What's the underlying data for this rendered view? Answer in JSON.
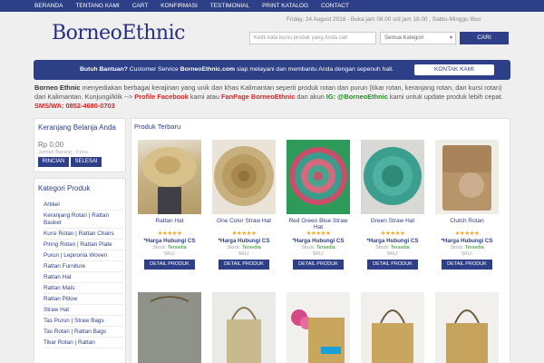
{
  "nav": [
    "BERANDA",
    "TENTANG KAMI",
    "CART",
    "KONFIRMASI",
    "TESTIMONIAL",
    "PRINT KATALOG",
    "CONTACT"
  ],
  "logo": "BorneoEthnic",
  "header": {
    "date_info": "Friday, 24 August 2018 - Buka jam 08.00 s/d jam 18.00 , Sabtu-Minggu libur",
    "search_placeholder": "Ketik kata kunci produk yang Anda cari",
    "category_select": "Semua Kategori",
    "search_button": "CARI"
  },
  "help": {
    "lead": "Butuh Bantuan?",
    "text1": " Customer Service ",
    "brand": "BorneoEthnic.com",
    "text2": " siap melayani dan membantu Anda dengan sepenuh hati.",
    "button": "KONTAK KAMI"
  },
  "intro": {
    "brand": "Borneo Ethnic",
    "p1": " menyediakan berbagai kerajinan yang unik dan khas Kalimantan seperti produk rotan dan purun (tikar rotan, keranjang rotan, dan kursi rotan) dari Kalimantan. Kunjungi/klik --> ",
    "fb": "Profile Facebook",
    "p2": " kami atau ",
    "fp": "FanPage BorneoEthnic",
    "p3": " dan akun ",
    "ig": "IG: @BorneoEthnic",
    "p4": " kami untuk update produk lebih cepat. ",
    "sms": "SMS/WA: 0852-4680-0703"
  },
  "cart": {
    "title": "Keranjang Belanja Anda",
    "total": "Rp 0,00",
    "count": "Jumlah Barang : 0 pcs",
    "btn_details": "RINCIAN",
    "btn_done": "SELESAI"
  },
  "categories": {
    "title": "Kategori Produk",
    "items": [
      "Artikel",
      "Keranjang Rotan | Rattan Basket",
      "Kursi Rotan | Rattan Chairs",
      "Piring Rotan | Rattan Plate",
      "Purun | Lepironia Woven",
      "Rattan Furniture",
      "Rattan Hat",
      "Rattan Mats",
      "Rattan Pillow",
      "Straw Hat",
      "Tas Purun | Straw Bags",
      "Tas Rotan | Rattan Bags",
      "Tikar Rotan | Rattan"
    ]
  },
  "products": {
    "title": "Produk Terbaru",
    "items": [
      {
        "name": "Rattan Hat",
        "stars": "★★★★★",
        "price": "*Harga Hubungi CS",
        "stock_label": "Stock: ",
        "stock": "Tersedia",
        "sku": "SKU:",
        "btn": "DETAIL PRODUK"
      },
      {
        "name": "One Color Straw Hat",
        "stars": "★★★★★",
        "price": "*Harga Hubungi CS",
        "stock_label": "Stock: ",
        "stock": "Tersedia",
        "sku": "SKU:",
        "btn": "DETAIL PRODUK"
      },
      {
        "name": "Red Green Blue Straw Hat",
        "stars": "★★★★★",
        "price": "*Harga Hubungi CS",
        "stock_label": "Stock: ",
        "stock": "Tersedia",
        "sku": "SKU:",
        "btn": "DETAIL PRODUK"
      },
      {
        "name": "Green Straw Hat",
        "stars": "★★★★★",
        "price": "*Harga Hubungi CS",
        "stock_label": "Stock: ",
        "stock": "Tersedia",
        "sku": "SKU:",
        "btn": "DETAIL PRODUK"
      },
      {
        "name": "Clutch Rotan",
        "stars": "★★★★★",
        "price": "*Harga Hubungi CS",
        "stock_label": "Stock: ",
        "stock": "Tersedia",
        "sku": "SKU:",
        "btn": "DETAIL PRODUK"
      }
    ]
  },
  "colors": {
    "primary": "#2d3f87",
    "accent": "#d9221e",
    "green": "#2a8a2a",
    "star": "#f5a623"
  }
}
